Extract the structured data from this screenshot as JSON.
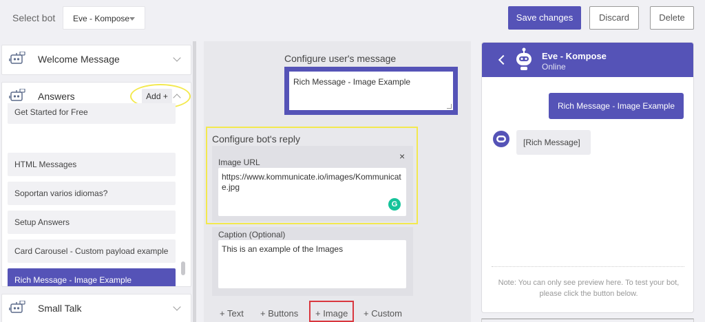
{
  "header": {
    "select_label": "Select bot",
    "bot_select_value": "Eve - Kompose",
    "save_label": "Save changes",
    "discard_label": "Discard",
    "delete_label": "Delete"
  },
  "sidebar": {
    "sections": [
      {
        "title": "Welcome Message",
        "icon": "robot-icon",
        "expanded": false
      },
      {
        "title": "Answers",
        "icon": "robot-icon",
        "expanded": true,
        "add_label": "Add +"
      },
      {
        "title": "Small Talk",
        "icon": "robot-icon",
        "expanded": false
      }
    ],
    "answers": [
      "Get Started for Free",
      "HTML Messages",
      "Soportan varios idiomas?",
      "Setup Answers",
      "Card Carousel - Custom payload example",
      "Rich Message - Image Example"
    ],
    "active_answer": "Rich Message - Image Example"
  },
  "editor": {
    "user_msg_label": "Configure user's message",
    "user_msg_value": "Rich Message - Image Example",
    "bot_reply_label": "Configure bot's reply",
    "image_url_label": "Image URL",
    "image_url_value": "https://www.kommunicate.io/images/Kommunicate.jpg",
    "close_symbol": "×",
    "grammarly_letter": "G",
    "caption_label": "Caption (Optional)",
    "caption_value": "This is an example of the Images",
    "add_text": "+ Text",
    "add_buttons": "+ Buttons",
    "add_image": "+ Image",
    "add_custom": "+ Custom"
  },
  "preview": {
    "bot_name": "Eve - Kompose",
    "bot_status": "Online",
    "user_bubble": "Rich Message - Image Example",
    "bot_bubble": "[Rich Message]",
    "note": "Note: You can only see preview here. To test your bot, please click the button below."
  },
  "colors": {
    "primary": "#5553b7",
    "highlight_yellow": "#f3e94e",
    "highlight_red": "#d9363e",
    "grammarly_green": "#15c39a"
  }
}
